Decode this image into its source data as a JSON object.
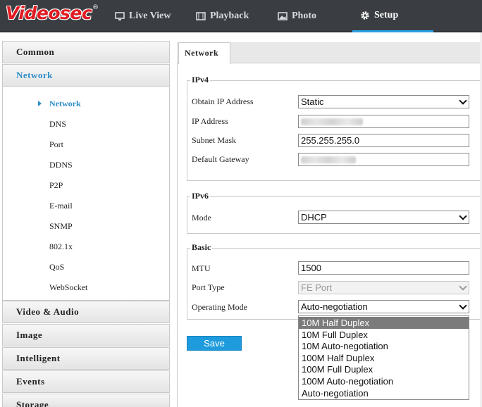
{
  "header": {
    "logo": "Videosec",
    "logo_mark": "®",
    "tabs": [
      {
        "label": "Live View",
        "icon": "monitor-icon"
      },
      {
        "label": "Playback",
        "icon": "film-icon"
      },
      {
        "label": "Photo",
        "icon": "image-icon"
      },
      {
        "label": "Setup",
        "icon": "gear-icon",
        "active": true
      }
    ]
  },
  "sidebar": {
    "sections": [
      "Common",
      "Network",
      "Video & Audio",
      "Image",
      "Intelligent",
      "Events",
      "Storage"
    ],
    "active_section": "Network",
    "network_items": [
      "Network",
      "DNS",
      "Port",
      "DDNS",
      "P2P",
      "E-mail",
      "SNMP",
      "802.1x",
      "QoS",
      "WebSocket"
    ],
    "active_item": "Network"
  },
  "main": {
    "tab": "Network",
    "ipv4": {
      "legend": "IPv4",
      "obtain_label": "Obtain IP Address",
      "obtain_value": "Static",
      "ip_label": "IP Address",
      "ip_value": "",
      "mask_label": "Subnet Mask",
      "mask_value": "255.255.255.0",
      "gateway_label": "Default Gateway",
      "gateway_value": ""
    },
    "ipv6": {
      "legend": "IPv6",
      "mode_label": "Mode",
      "mode_value": "DHCP"
    },
    "basic": {
      "legend": "Basic",
      "mtu_label": "MTU",
      "mtu_value": "1500",
      "port_type_label": "Port Type",
      "port_type_value": "FE Port",
      "op_mode_label": "Operating Mode",
      "op_mode_value": "Auto-negotiation",
      "op_mode_options": [
        "10M Half Duplex",
        "10M Full Duplex",
        "10M Auto-negotiation",
        "100M Half Duplex",
        "100M Full Duplex",
        "100M Auto-negotiation",
        "Auto-negotiation"
      ],
      "highlighted_option": "10M Half Duplex"
    },
    "save_label": "Save"
  },
  "colors": {
    "accent": "#2d8ec7",
    "header_bg": "#3a3d42",
    "logo_red": "#e21b23",
    "save_bg": "#1e9bdc",
    "option_highlight": "#7b7b7b"
  }
}
